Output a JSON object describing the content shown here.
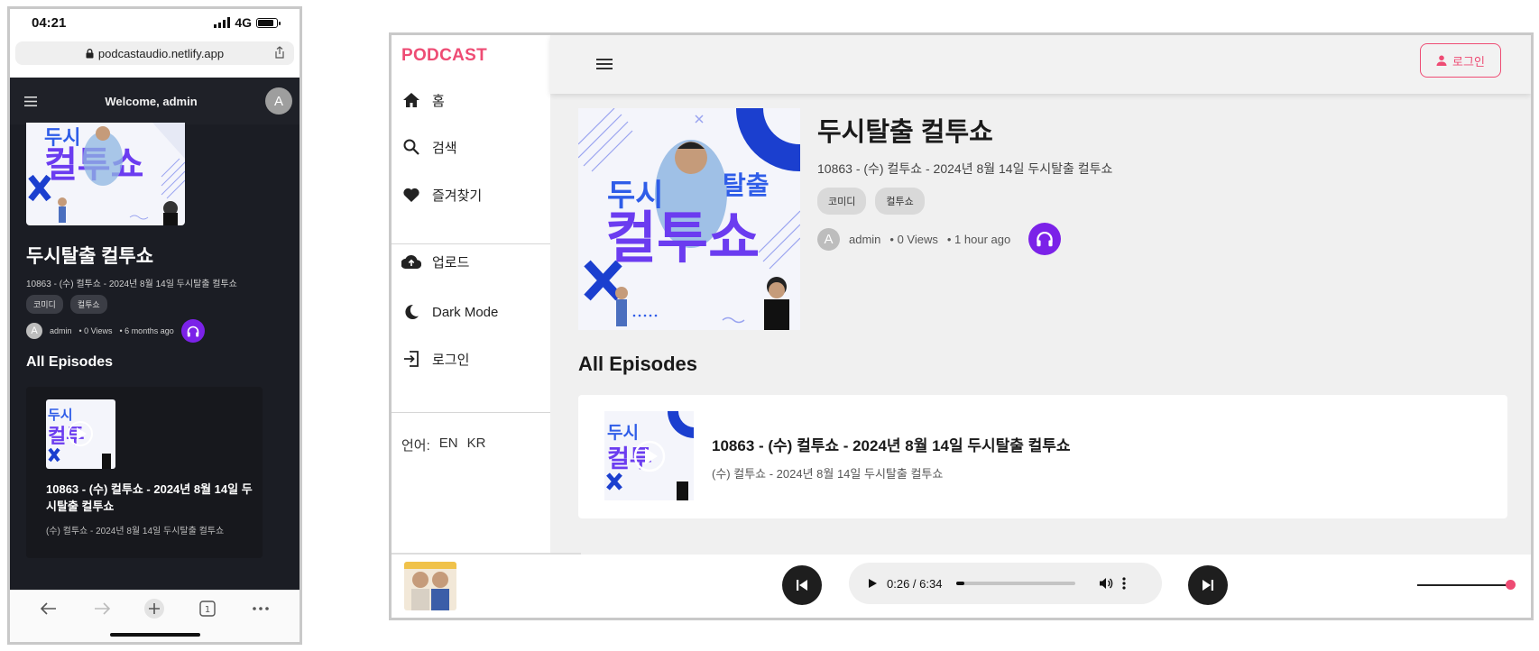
{
  "colors": {
    "brand": "#ee4c74",
    "accent_purple": "#7b22e8",
    "dark_bg": "#1b1d24"
  },
  "phone": {
    "status": {
      "time": "04:21",
      "network": "4G"
    },
    "url": "podcastaudio.netlify.app",
    "header": {
      "welcome": "Welcome, admin",
      "avatar": "A"
    },
    "podcast": {
      "title": "두시탈출 컬투쇼",
      "subtitle": "10863 - (수) 컬투쇼 - 2024년 8월 14일 두시탈출 컬투쇼",
      "tags": [
        "코미디",
        "컬투쇼"
      ],
      "author_avatar": "A",
      "author": "admin",
      "views": "• 0 Views",
      "time": "• 6 months ago"
    },
    "all_episodes": "All Episodes",
    "episode": {
      "title": "10863 - (수) 컬투쇼 - 2024년 8월 14일 두시탈출 컬투쇼",
      "subtitle": "(수) 컬투쇼 - 2024년 8월 14일 두시탈출 컬투쇼"
    },
    "toolbar": {
      "tabs_count": "1"
    }
  },
  "desktop": {
    "brand": "PODCAST",
    "nav": [
      {
        "label": "홈",
        "icon": "home-icon"
      },
      {
        "label": "검색",
        "icon": "search-icon"
      },
      {
        "label": "즐겨찾기",
        "icon": "heart-icon"
      },
      {
        "label": "업로드",
        "icon": "cloud-upload-icon"
      },
      {
        "label": "Dark Mode",
        "icon": "moon-icon"
      },
      {
        "label": "로그인",
        "icon": "login-icon"
      }
    ],
    "language": {
      "label": "언어:",
      "options": [
        "EN",
        "KR"
      ]
    },
    "login_button": "로그인",
    "podcast": {
      "title": "두시탈출 컬투쇼",
      "subtitle": "10863 - (수) 컬투쇼 - 2024년 8월 14일 두시탈출 컬투쇼",
      "tags": [
        "코미디",
        "컬투쇼"
      ],
      "author_avatar": "A",
      "author": "admin",
      "views": "• 0 Views",
      "time": "• 1 hour ago"
    },
    "all_episodes": "All Episodes",
    "episode": {
      "title": "10863 - (수) 컬투쇼 - 2024년 8월 14일 두시탈출 컬투쇼",
      "subtitle": "(수) 컬투쇼 - 2024년 8월 14일 두시탈출 컬투쇼"
    },
    "player": {
      "time": "0:26 / 6:34",
      "progress_fraction": 0.066,
      "volume_fraction": 1.0
    }
  }
}
